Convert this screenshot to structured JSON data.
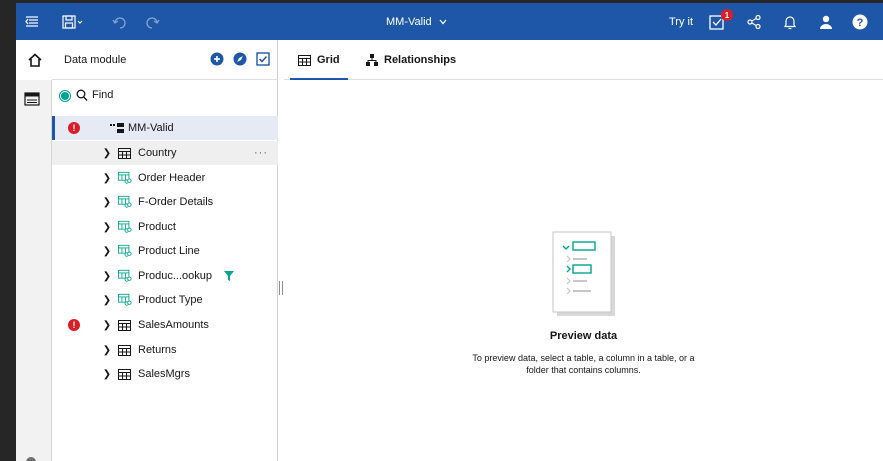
{
  "topbar": {
    "title": "MM-Valid",
    "try_it": "Try it",
    "notification_count": "1"
  },
  "panel": {
    "title": "Data module",
    "find_label": "Find"
  },
  "tree": {
    "root": "MM-Valid",
    "items": [
      {
        "label": "Country",
        "icon": "table-icon",
        "error": false
      },
      {
        "label": "Order Header",
        "icon": "linked-table-icon",
        "error": false
      },
      {
        "label": "F-Order Details",
        "icon": "linked-table-icon",
        "error": false
      },
      {
        "label": "Product",
        "icon": "linked-table-icon",
        "error": false
      },
      {
        "label": "Product Line",
        "icon": "linked-table-icon",
        "error": false
      },
      {
        "label": "Produc...ookup",
        "icon": "linked-table-icon",
        "error": false,
        "filtered": true
      },
      {
        "label": "Product Type",
        "icon": "linked-table-icon",
        "error": false
      },
      {
        "label": "SalesAmounts",
        "icon": "table-icon",
        "error": true
      },
      {
        "label": "Returns",
        "icon": "table-icon",
        "error": false
      },
      {
        "label": "SalesMgrs",
        "icon": "table-icon",
        "error": false
      }
    ],
    "more_label": "···"
  },
  "tabs": [
    {
      "label": "Grid",
      "active": true
    },
    {
      "label": "Relationships",
      "active": false
    }
  ],
  "preview": {
    "title": "Preview data",
    "description": "To preview data, select a table, a column in a table, or a folder that contains columns."
  },
  "colors": {
    "brand": "#1f57a8",
    "error": "#da1e28",
    "accent": "#00a68f"
  }
}
